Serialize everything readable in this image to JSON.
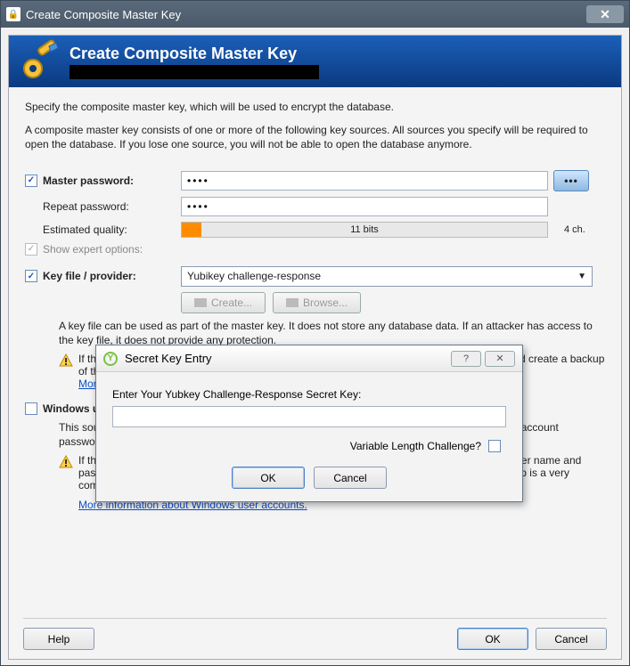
{
  "window": {
    "title": "Create Composite Master Key"
  },
  "header": {
    "title": "Create Composite Master Key"
  },
  "intro": {
    "p1": "Specify the composite master key, which will be used to encrypt the database.",
    "p2": "A composite master key consists of one or more of the following key sources. All sources you specify will be required to open the database. If you lose one source, you will not be able to open the database anymore."
  },
  "master": {
    "label": "Master password:",
    "repeat_label": "Repeat password:",
    "value": "••••",
    "repeat_value": "••••",
    "quality_label": "Estimated quality:",
    "quality_text": "11 bits",
    "chars": "4 ch.",
    "expert_label": "Show expert options:"
  },
  "keyfile": {
    "label": "Key file / provider:",
    "selected": "Yubikey challenge-response",
    "create": "Create...",
    "browse": "Browse...",
    "note": "A key file can be used as part of the master key. It does not store any database data. If an attacker has access to the key file, it does not provide any protection.",
    "warn": "If the location of the key file changes, you must update the path in the key sources. You should create a backup of the key file.",
    "more": "More information about key files."
  },
  "wua": {
    "label": "Windows user account",
    "note": "This source uses data of the current Windows user account. This data does not change when the account password changes.",
    "warn": "If the Windows user account is lost, it is not enough to create a new account with the same user name and password. A complete backup of the account is required. Creating and restoring such a backup is a very complicated task. If you don't know how to do this, don't enable this option.",
    "more": "More information about Windows user accounts."
  },
  "buttons": {
    "help": "Help",
    "ok": "OK",
    "cancel": "Cancel"
  },
  "modal": {
    "title": "Secret Key Entry",
    "prompt": "Enter Your Yubkey Challenge-Response Secret Key:",
    "varlen": "Variable Length Challenge?",
    "ok": "OK",
    "cancel": "Cancel"
  }
}
